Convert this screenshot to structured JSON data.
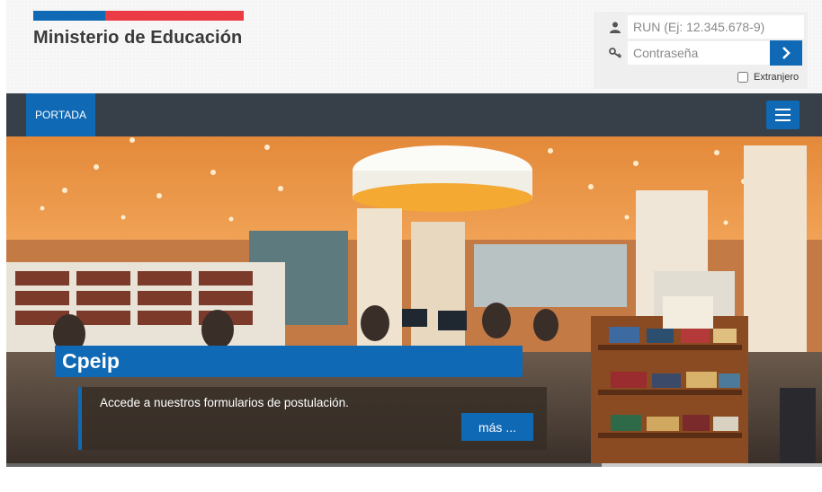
{
  "header": {
    "ministry_name": "Ministerio de Educación",
    "flag_colors": {
      "blue": "#0f69b4",
      "red": "#eb3c46"
    }
  },
  "login": {
    "run_placeholder": "RUN (Ej: 12.345.678-9)",
    "password_placeholder": "Contraseña",
    "foreign_label": "Extranjero",
    "icons": {
      "run": "user-icon",
      "password": "key-icon",
      "submit": "chevron-right-icon"
    }
  },
  "nav": {
    "tab_label": "PORTADA",
    "menu_icon": "hamburger-menu-icon",
    "bar_color": "#373f48",
    "accent": "#0f69b4"
  },
  "hero": {
    "title": "Cpeip",
    "description": "Accede a nuestros formularios de postulación.",
    "more_label": "más ...",
    "progress": 0.73
  }
}
